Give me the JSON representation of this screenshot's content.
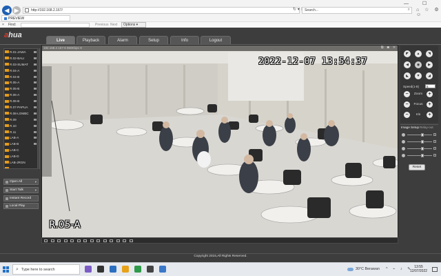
{
  "browser": {
    "address": "http://192.168.2.167/",
    "search_placeholder": "Search...",
    "tab_title": "PREVIEW",
    "find": {
      "close": "×",
      "label": "Find:",
      "previous": "Previous",
      "next": "Next",
      "options": "Options ▾"
    },
    "window_controls": "—  ☐  ✕",
    "addr_actions": "↻ ▾ ✕",
    "tool_icons": "⌂ ☆ ⚙ ☺"
  },
  "app": {
    "logo_prefix": "a",
    "logo_rest": "hua",
    "tabs": [
      {
        "label": "Live",
        "active": true
      },
      {
        "label": "Playback"
      },
      {
        "label": "Alarm"
      },
      {
        "label": "Setup"
      },
      {
        "label": "Info"
      },
      {
        "label": "Logout"
      }
    ],
    "channels": [
      {
        "label": "R.01-JAWA",
        "m": "M"
      },
      {
        "label": "R.02-BALI",
        "m": "M"
      },
      {
        "label": "R.03-SUMAT",
        "m": "M"
      },
      {
        "label": "R.04-A",
        "m": "M"
      },
      {
        "label": "R.04-B",
        "m": "M"
      },
      {
        "label": "R.05-A",
        "m": "M"
      },
      {
        "label": "R.05-B",
        "m": "M"
      },
      {
        "label": "R.06-A",
        "m": "M"
      },
      {
        "label": "R.06-B",
        "m": "M"
      },
      {
        "label": "R.07-PAPUA",
        "m": "M"
      },
      {
        "label": "R.08-LOMBC",
        "m": "M"
      },
      {
        "label": "R.09",
        "m": "M"
      },
      {
        "label": "R.10",
        "m": "M"
      },
      {
        "label": "R.11",
        "m": "M"
      },
      {
        "label": "LAB-A",
        "m": "M"
      },
      {
        "label": "LAB-B",
        "m": "M"
      },
      {
        "label": "LAB-C",
        "m": ""
      },
      {
        "label": "LAB-D",
        "m": ""
      },
      {
        "label": "LAB-JRGN",
        "m": ""
      },
      {
        "label": "...",
        "m": ""
      }
    ],
    "left_buttons": [
      {
        "label": "Open All",
        "caret": "▾"
      },
      {
        "label": "Start Talk",
        "caret": "▾"
      },
      {
        "label": "Instant Record",
        "caret": ""
      },
      {
        "label": "Local Play",
        "caret": ""
      }
    ],
    "video": {
      "info": "192.168.2.167-6 960Kbps H",
      "ctrl_icons": "⧉ ◙ ✕",
      "osd_time": "2022-12-07 13:54:37",
      "osd_room": "R.05-A"
    },
    "ptz": {
      "arrows": [
        "◤",
        "▲",
        "◥",
        "◀",
        "◉",
        "▶",
        "◣",
        "▼",
        "◢"
      ],
      "speed_label": "Speed(1-8)",
      "speed_value": "5",
      "rows": [
        {
          "label": "Zoom",
          "minus": "−",
          "plus": "+"
        },
        {
          "label": "Focus",
          "minus": "−",
          "plus": "+"
        },
        {
          "label": "Iris",
          "minus": "−",
          "plus": "+"
        }
      ]
    },
    "image_setup_label": "Image Setup",
    "relay_out_label": "Relay-out",
    "reset_label": "Reset",
    "copyright": "Copyright 2015,All Rights Reserved."
  },
  "taskbar": {
    "search_placeholder": "Type here to search",
    "weather": "30°C  Berawan",
    "tray": "^ ⌁ ♪ ✎",
    "time": "13:55",
    "date": "12/07/2022"
  },
  "colors": {
    "accent_orange": "#e39b1d",
    "brand_red": "#d83a2c",
    "windows_blue": "#1f6fc7"
  }
}
